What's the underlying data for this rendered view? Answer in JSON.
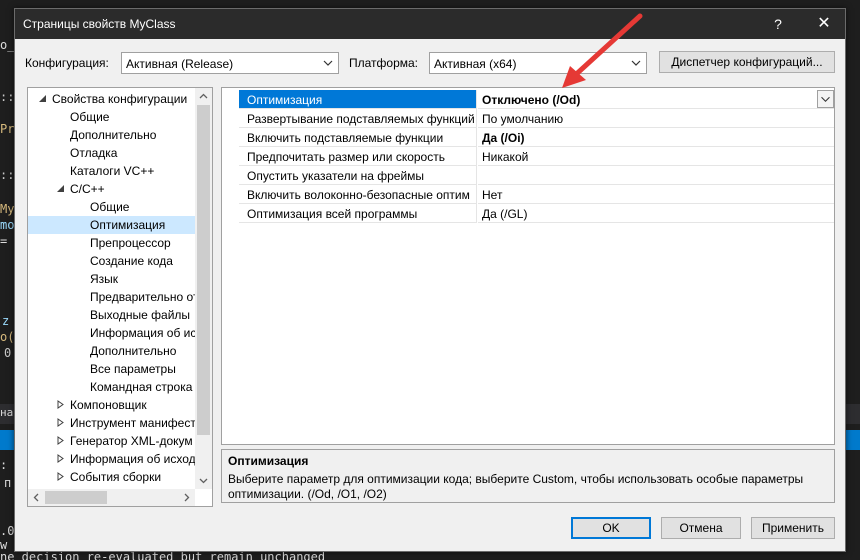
{
  "dialog": {
    "title": "Страницы свойств MyClass",
    "help_glyph": "?",
    "close_glyph": "✕"
  },
  "toolbar": {
    "config_label": "Конфигурация:",
    "config_value": "Активная (Release)",
    "platform_label": "Платформа:",
    "platform_value": "Активная (x64)",
    "config_manager_label": "Диспетчер конфигураций..."
  },
  "tree": {
    "items": [
      {
        "label": "Свойства конфигурации",
        "expanded": true
      },
      {
        "label": "Общие"
      },
      {
        "label": "Дополнительно"
      },
      {
        "label": "Отладка"
      },
      {
        "label": "Каталоги VC++"
      },
      {
        "label": "C/C++",
        "expanded": true
      },
      {
        "label": "Общие"
      },
      {
        "label": "Оптимизация",
        "selected": true
      },
      {
        "label": "Препроцессор"
      },
      {
        "label": "Создание кода"
      },
      {
        "label": "Язык"
      },
      {
        "label": "Предварительно от"
      },
      {
        "label": "Выходные файлы"
      },
      {
        "label": "Информация об ис"
      },
      {
        "label": "Дополнительно"
      },
      {
        "label": "Все параметры"
      },
      {
        "label": "Командная строка"
      },
      {
        "label": "Компоновщик",
        "expanded": false
      },
      {
        "label": "Инструмент манифест",
        "expanded": false
      },
      {
        "label": "Генератор XML-докум",
        "expanded": false
      },
      {
        "label": "Информация об исход",
        "expanded": false
      },
      {
        "label": "События сборки",
        "expanded": false
      }
    ]
  },
  "properties": [
    {
      "name": "Оптимизация",
      "value": "Отключено (/Od)",
      "bold": true,
      "selected": true
    },
    {
      "name": "Развертывание подставляемых функций",
      "value": "По умолчанию",
      "bold": false
    },
    {
      "name": "Включить подставляемые функции",
      "value": "Да (/Oi)",
      "bold": true
    },
    {
      "name": "Предпочитать размер или скорость",
      "value": "Никакой",
      "bold": false
    },
    {
      "name": "Опустить указатели на фреймы",
      "value": "",
      "bold": false
    },
    {
      "name": "Включить волоконно-безопасные оптим",
      "value": "Нет",
      "bold": false
    },
    {
      "name": "Оптимизация всей программы",
      "value": "Да (/GL)",
      "bold": false
    }
  ],
  "description": {
    "title": "Оптимизация",
    "text": "Выберите параметр для оптимизации кода; выберите Custom, чтобы использовать особые параметры оптимизации.    (/Od, /O1, /O2)"
  },
  "buttons": {
    "ok": "OK",
    "cancel": "Отмена",
    "apply": "Применить"
  },
  "background": {
    "frags": [
      "o_",
      "::",
      "Pr",
      "::",
      "My",
      "mo",
      "=",
      "z",
      "o(",
      "0",
      "на",
      ":",
      "п",
      ".0",
      "w",
      "ne decision re-evaluated but remain unchanged"
    ]
  },
  "colors": {
    "selection": "#0078d7",
    "tree_selection": "#cce8ff",
    "annotation_arrow": "#e53935",
    "titlebar": "#2b2b2b"
  }
}
